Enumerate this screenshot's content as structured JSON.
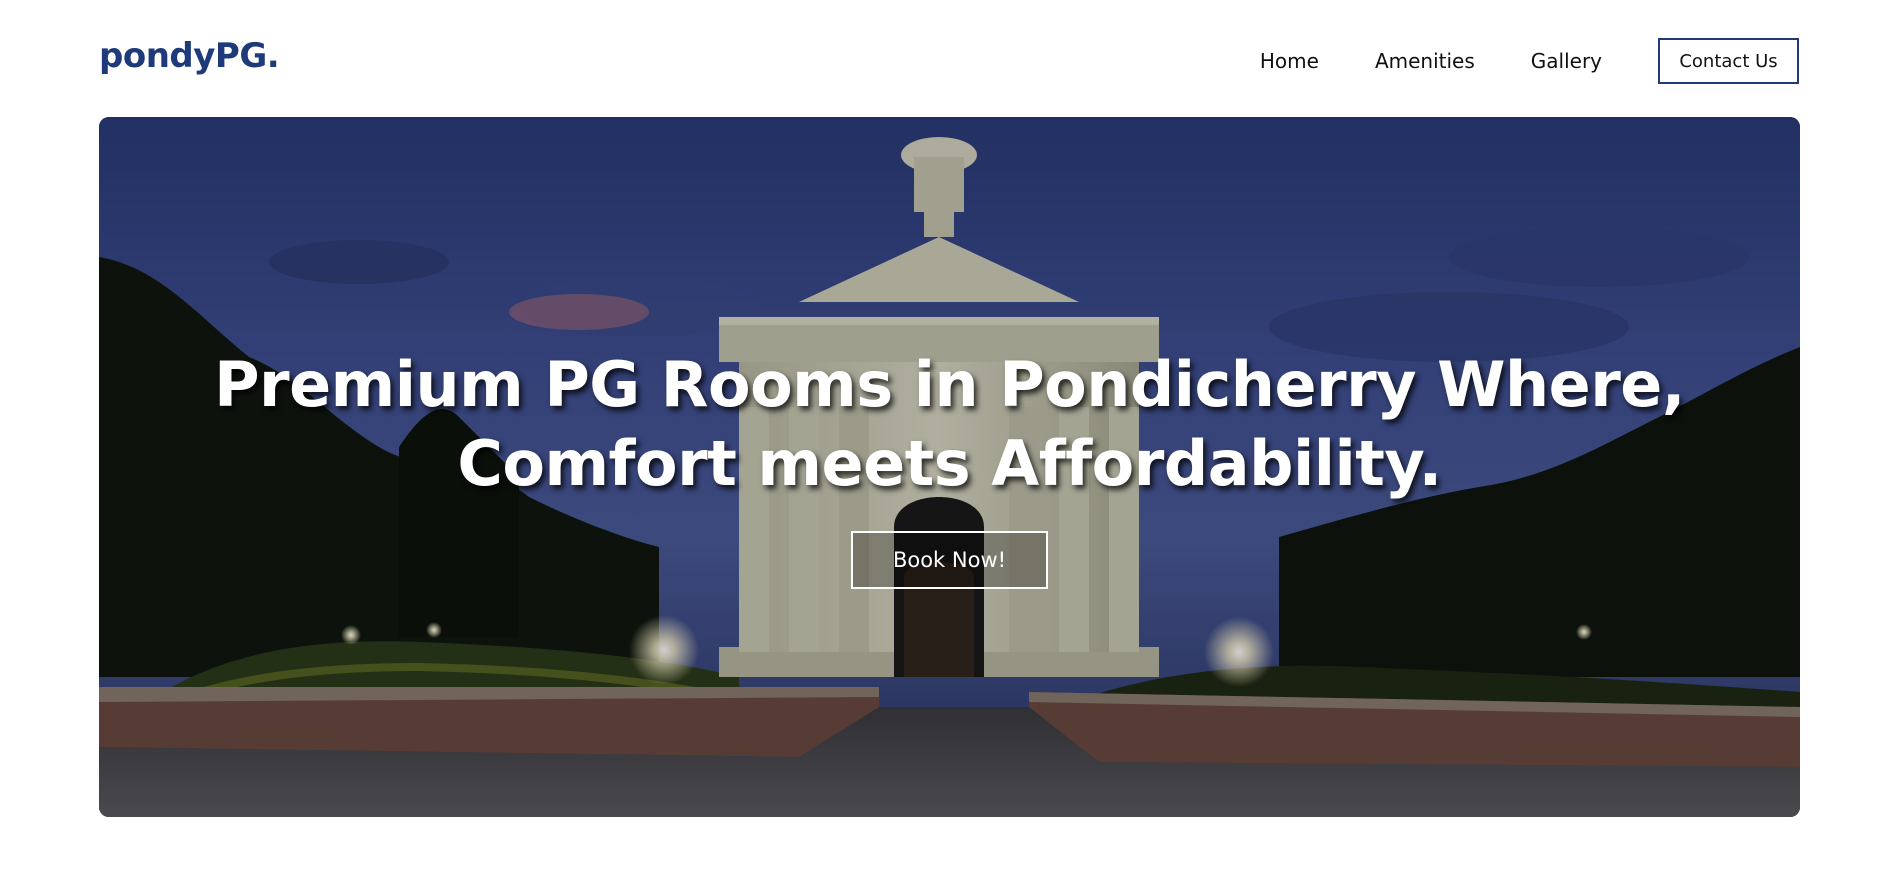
{
  "header": {
    "logo": "pondyPG.",
    "nav": {
      "home": "Home",
      "amenities": "Amenities",
      "gallery": "Gallery"
    },
    "contact_button": "Contact Us"
  },
  "hero": {
    "title_line1": "Premium PG Rooms in Pondicherry Where,",
    "title_line2": "Comfort meets Affordability.",
    "cta_button": "Book Now!"
  },
  "colors": {
    "brand": "#1f3a7a",
    "hero_text": "#ffffff"
  }
}
